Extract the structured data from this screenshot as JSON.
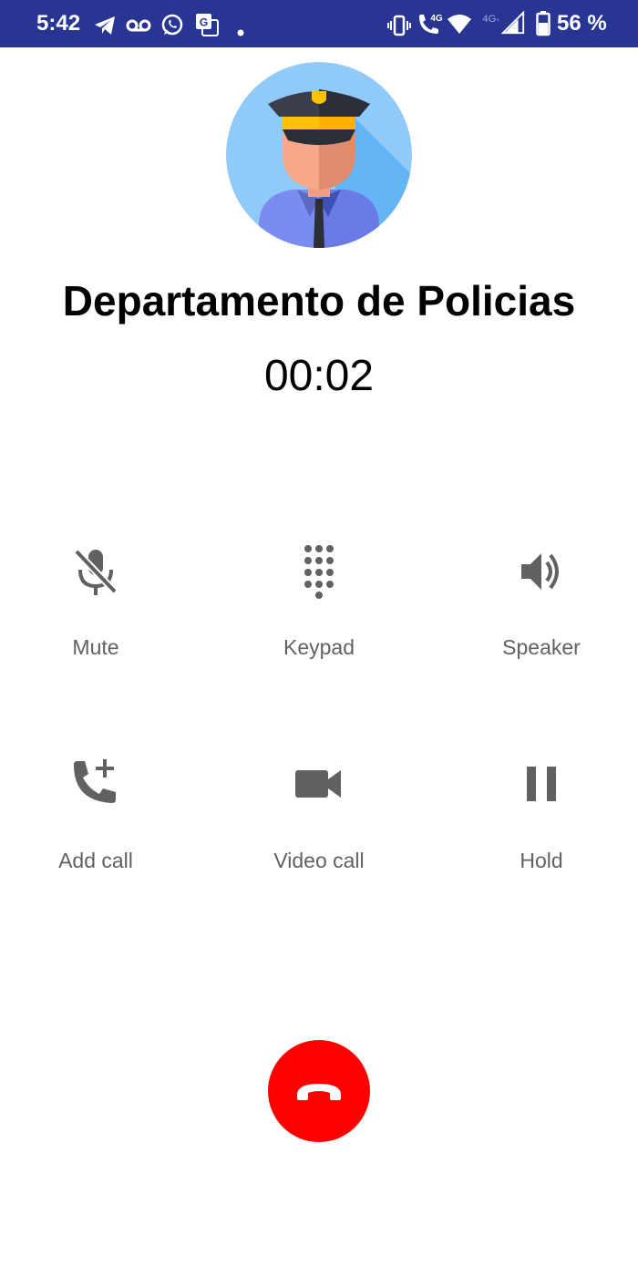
{
  "status_bar": {
    "time": "5:42",
    "battery": "56 %",
    "background": "#283593"
  },
  "contact": {
    "name": "Departamento de Policias",
    "duration": "00:02"
  },
  "controls": [
    {
      "label": "Mute",
      "icon": "mic-off-icon"
    },
    {
      "label": "Keypad",
      "icon": "dialpad-icon"
    },
    {
      "label": "Speaker",
      "icon": "speaker-icon"
    },
    {
      "label": "Add call",
      "icon": "add-call-icon"
    },
    {
      "label": "Video call",
      "icon": "video-camera-icon"
    },
    {
      "label": "Hold",
      "icon": "pause-icon"
    }
  ],
  "end_call": {
    "icon": "hang-up-icon",
    "color": "#ff0000"
  },
  "colors": {
    "control_icon": "#616161",
    "control_label": "#616161"
  }
}
